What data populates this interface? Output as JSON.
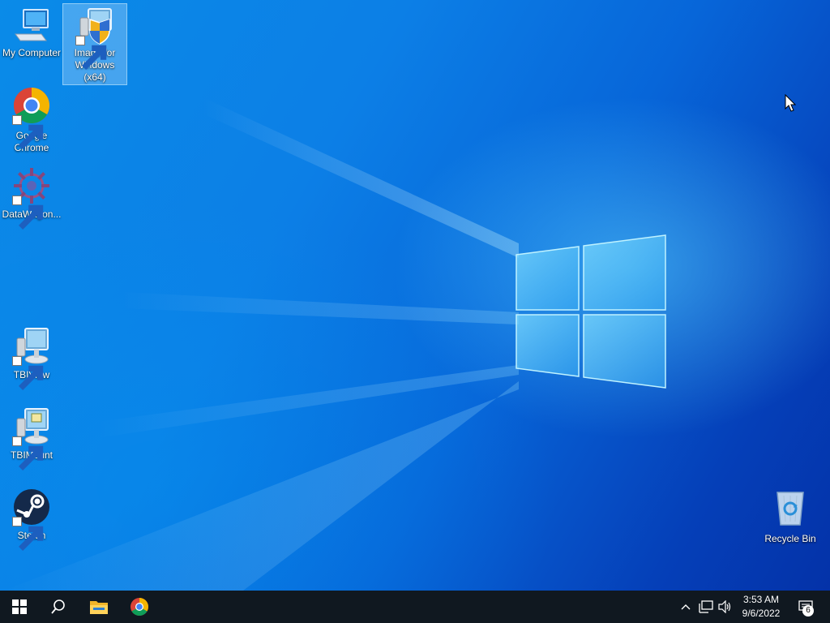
{
  "desktop": {
    "icons": [
      {
        "label": "My Computer"
      },
      {
        "label": "Image for Windows (x64)"
      },
      {
        "label": "Google Chrome"
      },
      {
        "label": "DataWagon..."
      },
      {
        "label": "TBIView"
      },
      {
        "label": "TBIMount"
      },
      {
        "label": "Steam"
      },
      {
        "label": "Recycle Bin"
      }
    ],
    "selected_icon": "Image for Windows (x64)"
  },
  "taskbar": {
    "start": {
      "icon": "windows-logo-icon"
    },
    "search": {
      "icon": "search-icon"
    },
    "pinned": [
      {
        "icon": "file-explorer-icon"
      },
      {
        "icon": "chrome-icon"
      }
    ],
    "tray": {
      "icons": [
        "chevron-up-icon",
        "network-icon",
        "volume-icon"
      ],
      "time": "3:53 AM",
      "date": "9/6/2022",
      "notification_count": "6"
    }
  },
  "colors": {
    "taskbar": "#101820",
    "wallpaper_blue": "#0a8be8",
    "selection": "#b4dcff"
  }
}
